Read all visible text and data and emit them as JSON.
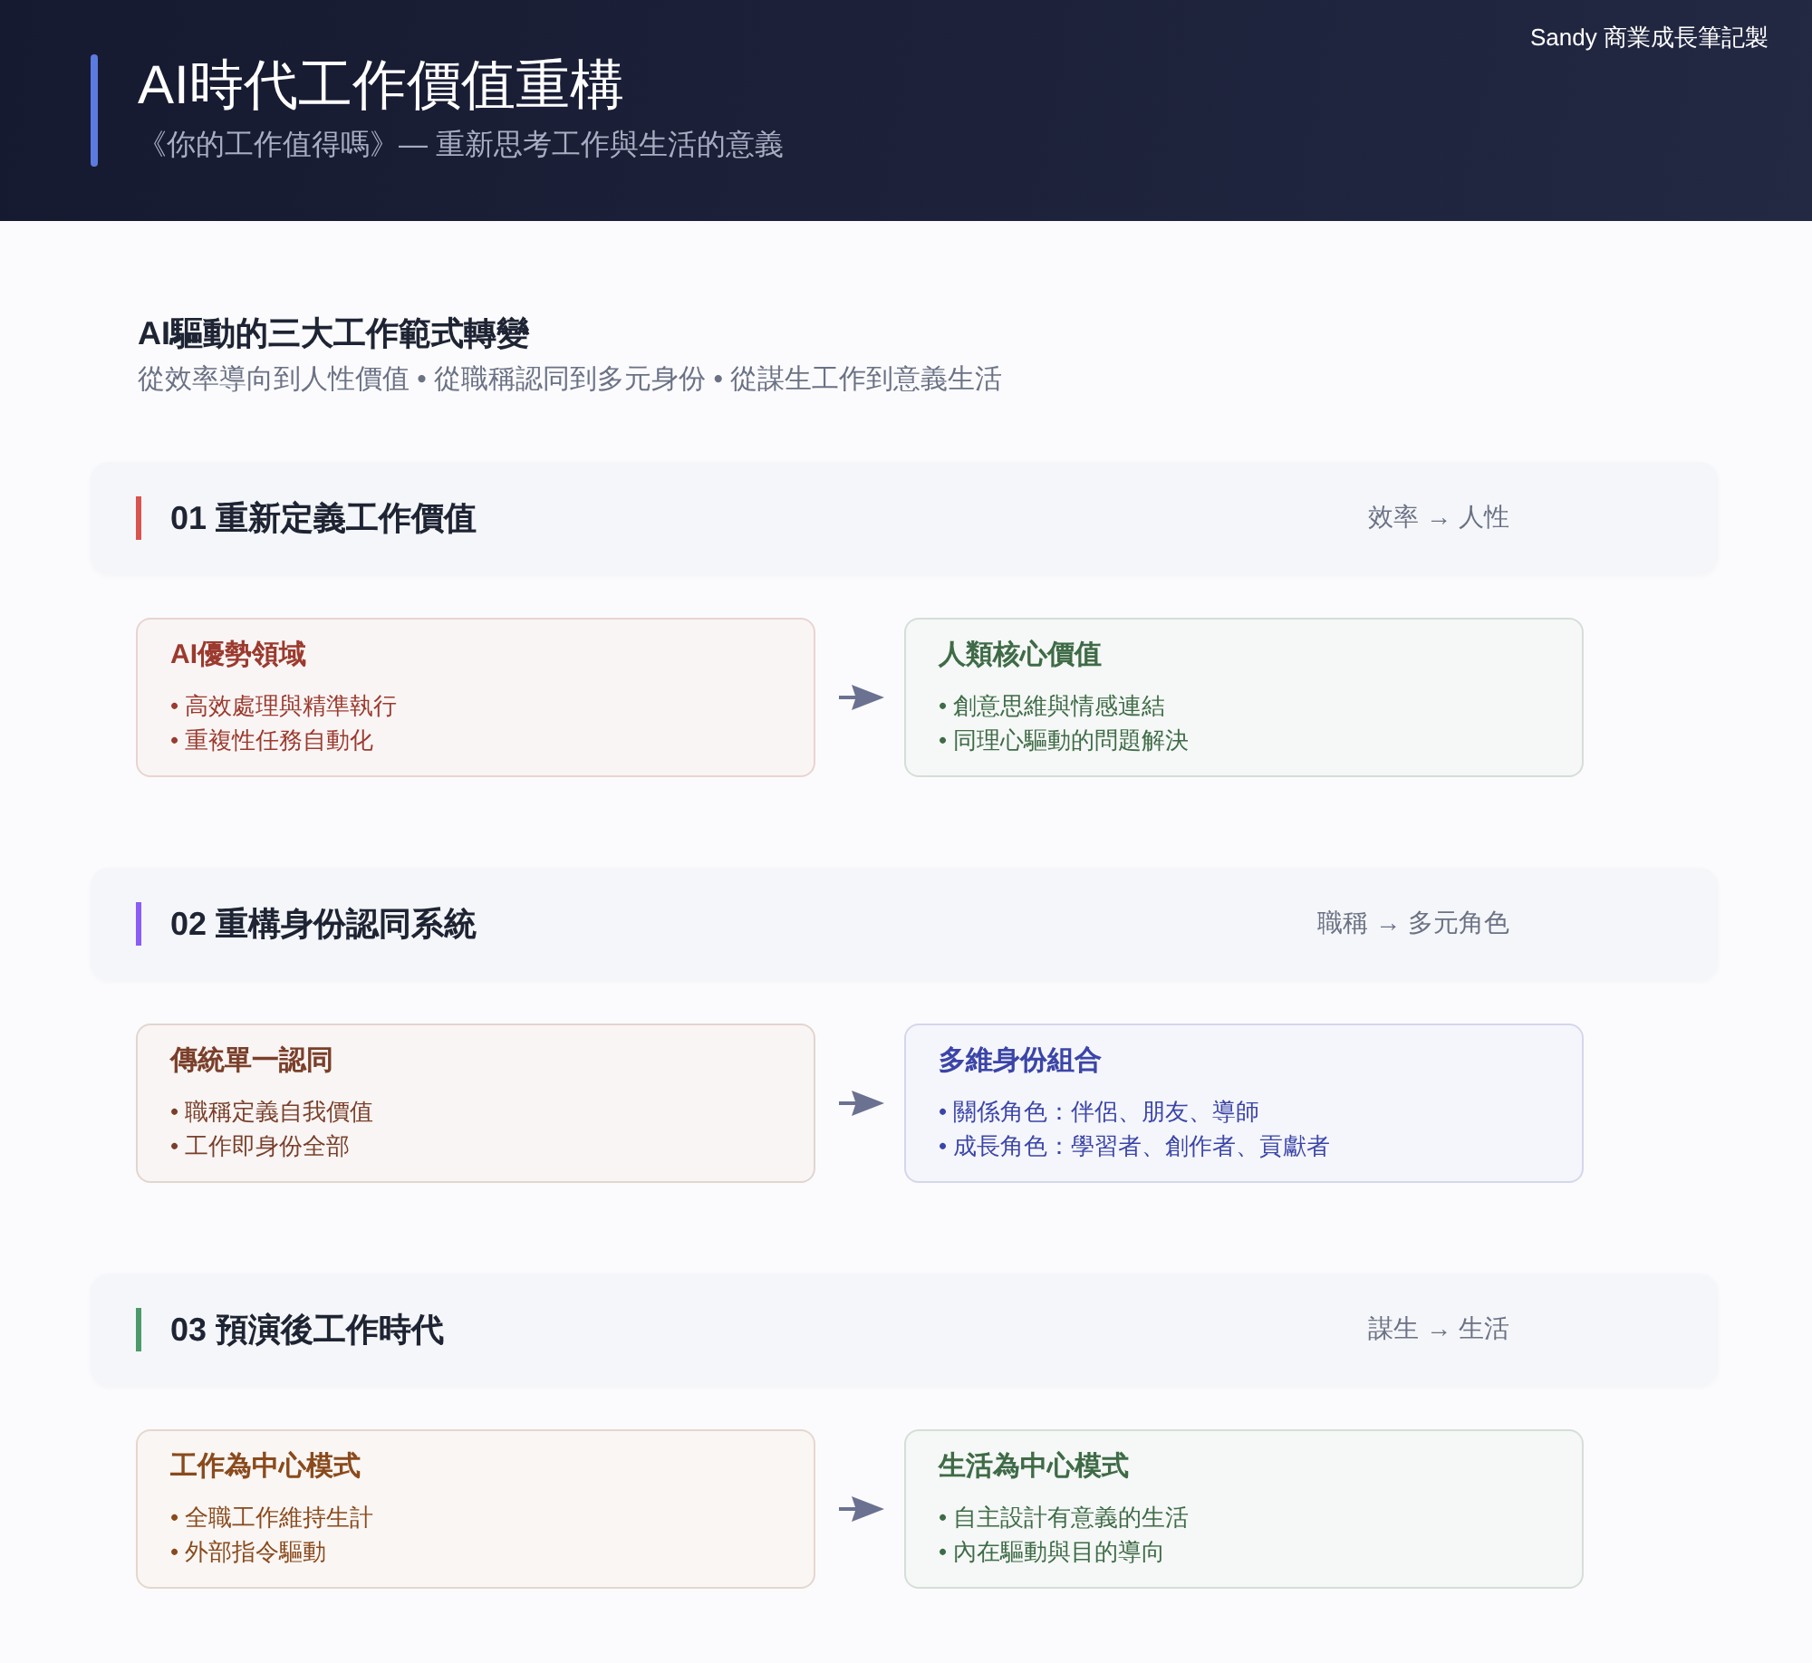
{
  "header": {
    "title": "AI時代工作價值重構",
    "subtitle": "《你的工作值得嗎》— 重新思考工作與生活的意義",
    "brand": "Sandy 商業成長筆記製"
  },
  "intro": {
    "heading": "AI驅動的三大工作範式轉變",
    "summary": "從效率導向到人性價值 • 從職稱認同到多元身份 • 從謀生工作到意義生活"
  },
  "sections": [
    {
      "title": "01 重新定義工作價值",
      "shift": "效率 → 人性",
      "color": "#d9534f",
      "cards": [
        {
          "title": "AI優勢領域",
          "color": "#9b3a2e",
          "items": [
            "• 高效處理與精準執行",
            "• 重複性任務自動化"
          ]
        },
        {
          "title": "人類核心價值",
          "color": "#3f6b47",
          "items": [
            "• 創意思維與情感連結",
            "• 同理心驅動的問題解決"
          ]
        }
      ]
    },
    {
      "title": "02 重構身份認同系統",
      "shift": "職稱 → 多元角色",
      "color": "#8b5cf6",
      "cards": [
        {
          "title": "傳統單一認同",
          "color": "#7a3f2a",
          "items": [
            "• 職稱定義自我價值",
            "• 工作即身份全部"
          ]
        },
        {
          "title": "多維身份組合",
          "color": "#3b45a8",
          "items": [
            "• 關係角色：伴侶、朋友、導師",
            "• 成長角色：學習者、創作者、貢獻者"
          ]
        }
      ]
    },
    {
      "title": "03 預演後工作時代",
      "shift": "謀生 → 生活",
      "color": "#4a9a6a",
      "cards": [
        {
          "title": "工作為中心模式",
          "color": "#8a4a1c",
          "items": [
            "• 全職工作維持生計",
            "• 外部指令驅動"
          ]
        },
        {
          "title": "生活為中心模式",
          "color": "#3f6b47",
          "items": [
            "• 自主設計有意義的生活",
            "• 內在驅動與目的導向"
          ]
        }
      ]
    }
  ]
}
